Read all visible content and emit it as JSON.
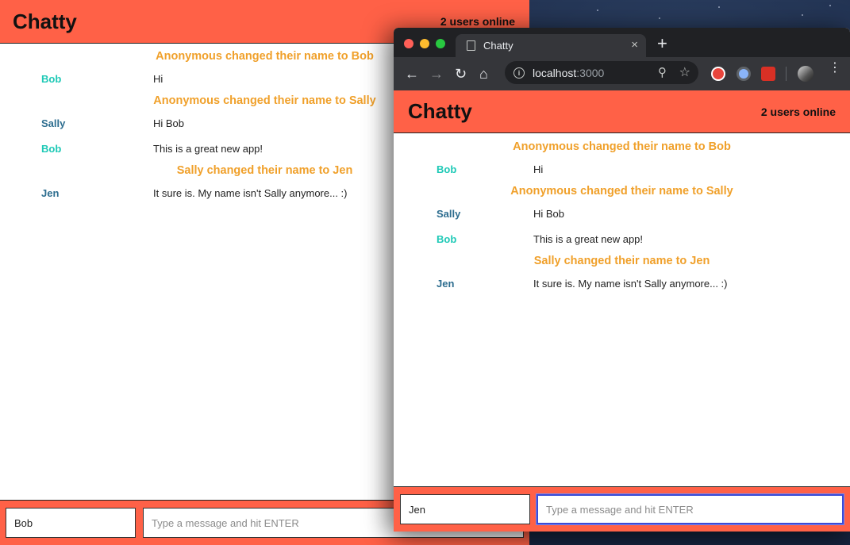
{
  "app": {
    "brand": "Chatty",
    "online": "2 users online"
  },
  "messages": [
    {
      "type": "system",
      "text": "Anonymous changed their name to Bob"
    },
    {
      "type": "message",
      "user": "Bob",
      "content": "Hi",
      "color": "#1ec9b6"
    },
    {
      "type": "system",
      "text": "Anonymous changed their name to Sally"
    },
    {
      "type": "message",
      "user": "Sally",
      "content": "Hi Bob",
      "color": "#2d6d8f"
    },
    {
      "type": "message",
      "user": "Bob",
      "content": "This is a great new app!",
      "color": "#1ec9b6"
    },
    {
      "type": "system",
      "text": "Sally changed their name to Jen"
    },
    {
      "type": "message",
      "user": "Jen",
      "content": "It sure is. My name isn't Sally anymore... :)",
      "color": "#2d6d8f"
    }
  ],
  "back_window": {
    "username_value": "Bob",
    "message_placeholder": "Type a message and hit ENTER"
  },
  "browser": {
    "tab_title": "Chatty",
    "url_host": "localhost",
    "url_port": ":3000",
    "tab_close": "×",
    "new_tab": "+"
  },
  "front_window": {
    "username_value": "Jen",
    "message_placeholder": "Type a message and hit ENTER"
  },
  "colors": {
    "navbar": "#ff6147",
    "system_message": "#f0a02a",
    "user_bob": "#1ec9b6",
    "user_sally": "#2d6d8f"
  }
}
